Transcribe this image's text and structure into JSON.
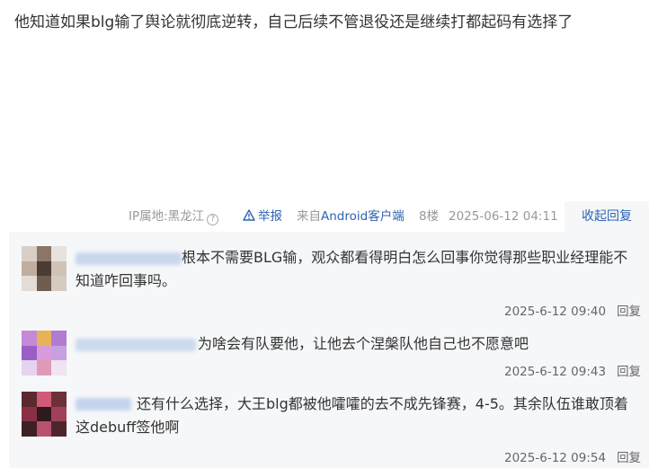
{
  "post": {
    "text": "他知道如果blg输了舆论就彻底逆转，自己后续不管退役还是继续打都起码有选择了"
  },
  "meta": {
    "ip_location": "IP属地:黑龙江",
    "report_label": "举报",
    "from_prefix": "来自",
    "client": "Android客户端",
    "floor": "8楼",
    "timestamp": "2025-06-12 04:11",
    "collapse_label": "收起回复"
  },
  "replies": [
    {
      "text": "根本不需要BLG输，观众都看得明白怎么回事你觉得那些职业经理能不知道咋回事吗。",
      "time": "2025-6-12 09:40",
      "reply_label": "回复"
    },
    {
      "text": "为啥会有队要他，让他去个涅槃队他自己也不愿意吧",
      "time": "2025-6-12 09:43",
      "reply_label": "回复"
    },
    {
      "text": "还有什么选择，大王blg都被他嚯嚯的去不成先锋赛，4-5。其余队伍谁敢顶着这debuff签他啊",
      "time": "2025-6-12 09:54",
      "reply_label": "回复"
    }
  ],
  "colors": {
    "link_blue": "#2d64b3",
    "reply_bg": "#f6f7f9",
    "meta_gray": "#999999"
  },
  "icons": {
    "help": "question-circle-icon",
    "report": "warning-triangle-icon"
  }
}
